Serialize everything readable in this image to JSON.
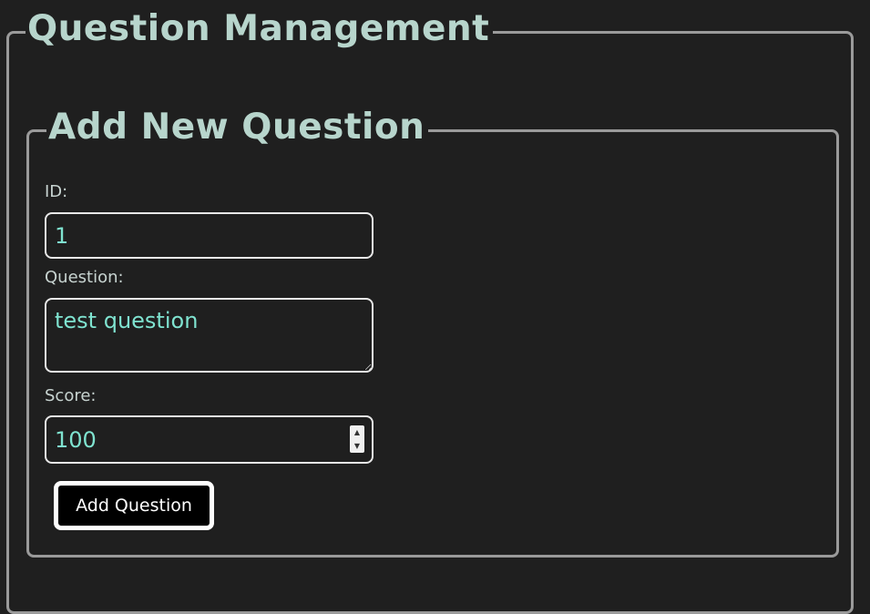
{
  "page": {
    "title": "Question Management"
  },
  "form": {
    "legend": "Add New Question",
    "id_label": "ID:",
    "id_value": "1",
    "question_label": "Question:",
    "question_value": "test question",
    "score_label": "Score:",
    "score_value": "100",
    "submit_label": "Add Question"
  },
  "colors": {
    "background": "#1f1f1f",
    "heading": "#b7d5cc",
    "input_text": "#7fe3d0",
    "border": "#9a9a9a"
  }
}
